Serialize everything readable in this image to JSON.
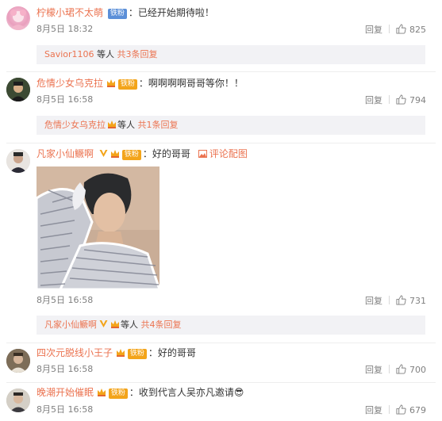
{
  "comments": [
    {
      "user": "柠檬小珺不太萌",
      "badge": "铁粉",
      "text": "：已经开始期待啦！",
      "time": "8月5日 18:32",
      "reply_label": "回复",
      "likes": "825",
      "sub": {
        "who": "Savior1106",
        "mid": " 等人 ",
        "more": "共3条回复"
      }
    },
    {
      "user": "危情少女乌克拉",
      "badge": "铁粉",
      "text": "：啊啊啊啊哥哥等你！！",
      "time": "8月5日 16:58",
      "reply_label": "回复",
      "likes": "794",
      "sub": {
        "who": "危情少女乌克拉",
        "mid": "等人 ",
        "more": "共1条回复"
      }
    },
    {
      "user": "凡家小仙鳜啊",
      "badge": "铁粉",
      "text": "：好的哥哥",
      "pic_label": "评论配图",
      "time": "8月5日 16:58",
      "reply_label": "回复",
      "likes": "731",
      "sub": {
        "who": "凡家小仙鳜啊",
        "mid": "等人 ",
        "more": "共4条回复"
      }
    },
    {
      "user": "四次元脱线小王子",
      "badge": "铁粉",
      "text": "：好的哥哥",
      "time": "8月5日 16:58",
      "reply_label": "回复",
      "likes": "700"
    },
    {
      "user": "晚潮开始催眠",
      "badge": "铁粉",
      "text": "：收到代言人吴亦凡邀请😎",
      "time": "8月5日 16:58",
      "reply_label": "回复",
      "likes": "679"
    }
  ],
  "icons": {
    "like": "thumbs-up-icon",
    "crown": "crown-icon",
    "verified": "verified-v-icon",
    "picture": "picture-icon"
  },
  "colors": {
    "username": "#eb7350",
    "meta": "#808080",
    "subbox_bg": "#f2f2f5",
    "iron_badge": "#5b8fd8",
    "gold_badge": "#f3a41a"
  }
}
